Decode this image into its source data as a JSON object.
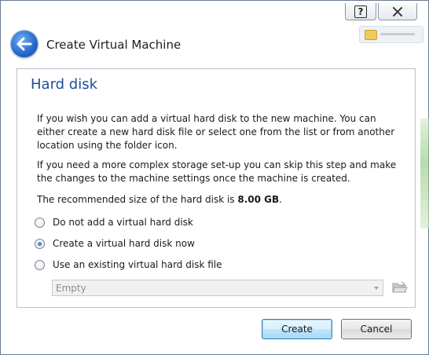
{
  "window": {
    "title": "Create Virtual Machine",
    "help_glyph": "?"
  },
  "page": {
    "heading": "Hard disk",
    "paragraph1": "If you wish you can add a virtual hard disk to the new machine. You can either create a new hard disk file or select one from the list or from another location using the folder icon.",
    "paragraph2": "If you need a more complex storage set-up you can skip this step and make the changes to the machine settings once the machine is created.",
    "recommended_prefix": "The recommended size of the hard disk is ",
    "recommended_size": "8.00 GB",
    "recommended_suffix": "."
  },
  "options": [
    {
      "label": "Do not add a virtual hard disk",
      "selected": false
    },
    {
      "label": "Create a virtual hard disk now",
      "selected": true
    },
    {
      "label": "Use an existing virtual hard disk file",
      "selected": false
    }
  ],
  "disk_select": {
    "value": "Empty",
    "enabled": false
  },
  "buttons": {
    "create": "Create",
    "cancel": "Cancel"
  },
  "icons": {
    "back": "back-arrow-icon",
    "folder": "folder-open-icon",
    "close": "close-icon",
    "help": "help-icon"
  },
  "colors": {
    "heading": "#1f4e99",
    "accent": "#2766c9"
  }
}
